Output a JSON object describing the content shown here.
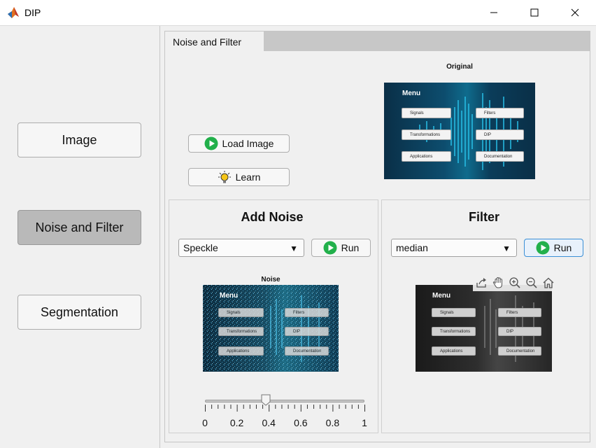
{
  "window": {
    "title": "DIP"
  },
  "sidebar": {
    "items": [
      {
        "label": "Image"
      },
      {
        "label": "Noise and Filter"
      },
      {
        "label": "Segmentation"
      }
    ]
  },
  "tabs": [
    {
      "label": "Noise and Filter"
    }
  ],
  "top": {
    "load_label": "Load Image",
    "learn_label": "Learn",
    "original_title": "Original"
  },
  "thumb_text": {
    "menu": "Menu",
    "items": [
      "Signals",
      "Filters",
      "Transformations",
      "DIP",
      "Applications",
      "Documentation"
    ]
  },
  "noise": {
    "title": "Add Noise",
    "dropdown_value": "Speckle",
    "run_label": "Run",
    "axes_title": "Noise",
    "slider": {
      "value": 0.38,
      "min": 0,
      "max": 1,
      "tick_labels": [
        "0",
        "0.2",
        "0.4",
        "0.6",
        "0.8",
        "1"
      ]
    }
  },
  "filter": {
    "title": "Filter",
    "dropdown_value": "median",
    "run_label": "Run"
  },
  "colors": {
    "run_green": "#22b04b",
    "accent": "#0078d7",
    "active_nav": "#b9b9b9"
  }
}
